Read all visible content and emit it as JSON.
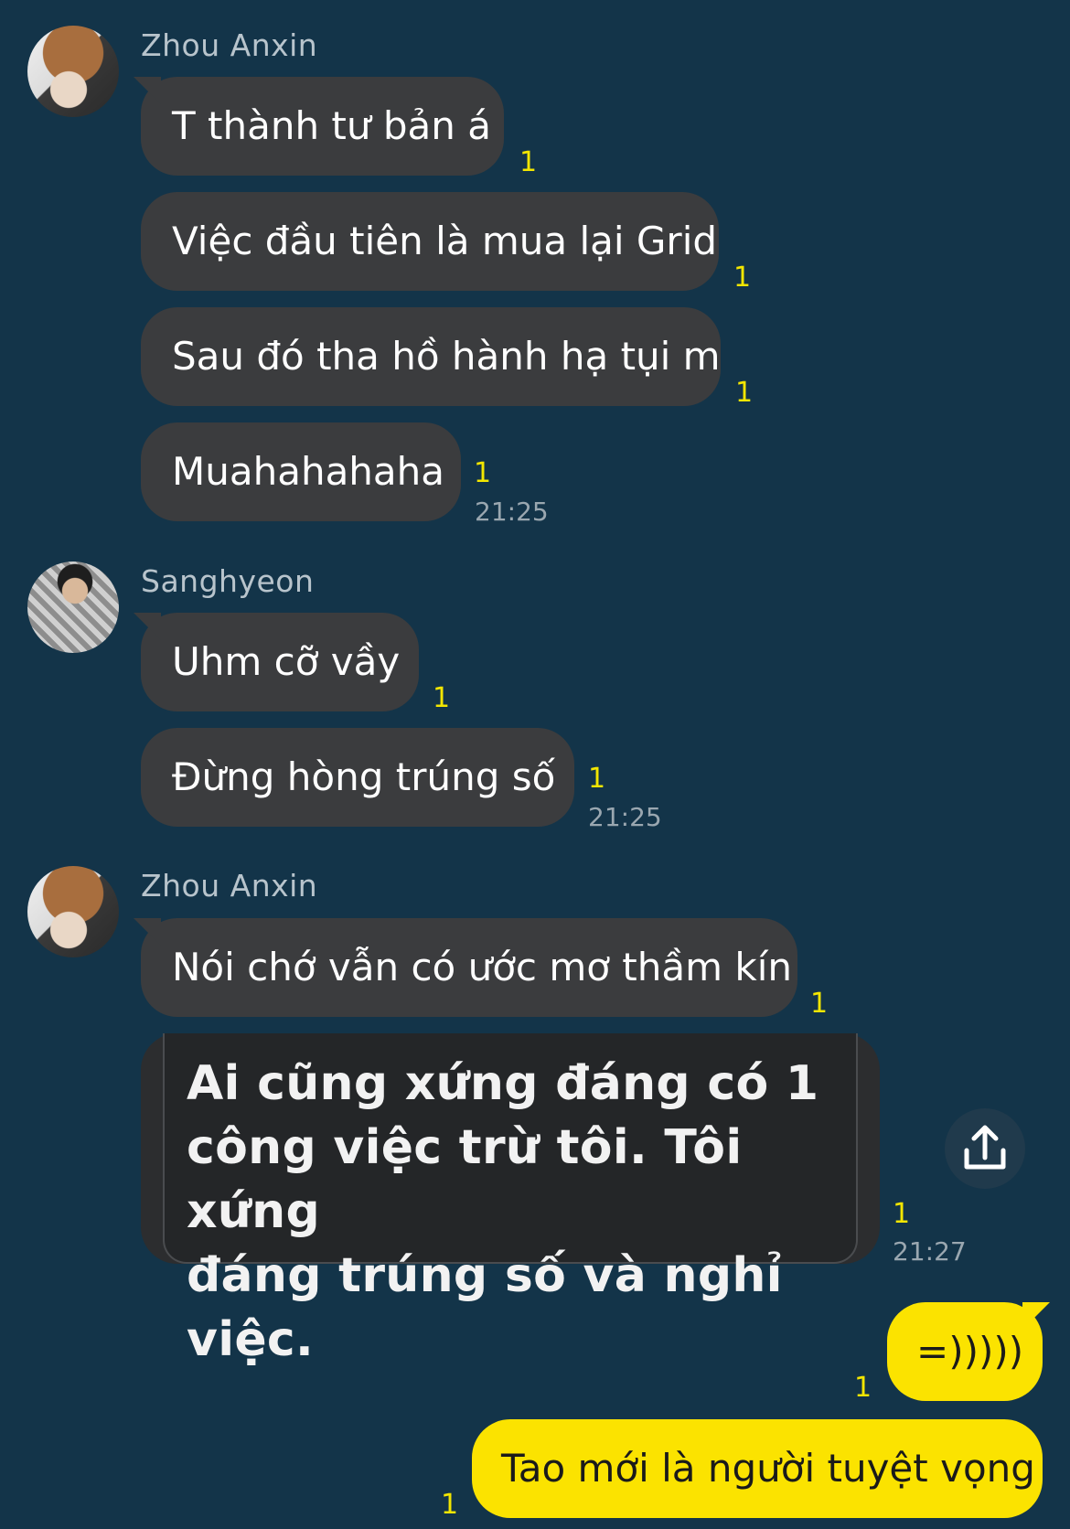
{
  "groups": [
    {
      "sender": "Zhou Anxin",
      "messages": [
        {
          "text": "T thành tư bản á",
          "count": "1"
        },
        {
          "text": "Việc đầu tiên là mua lại Grid",
          "count": "1"
        },
        {
          "text": "Sau đó tha hồ hành hạ tụi m",
          "count": "1"
        },
        {
          "text": "Muahahahaha",
          "count": "1"
        }
      ],
      "time": "21:25"
    },
    {
      "sender": "Sanghyeon",
      "messages": [
        {
          "text": "Uhm cỡ vầy",
          "count": "1"
        },
        {
          "text": "Đừng hòng trúng số",
          "count": "1"
        }
      ],
      "time": "21:25"
    },
    {
      "sender": "Zhou Anxin",
      "messages": [
        {
          "text": "Nói chớ vẫn có ước mơ thầm kín",
          "count": "1"
        }
      ],
      "quote": {
        "line1": "Ai cũng xứng đáng có 1",
        "line2": "công việc trừ tôi. Tôi xứng",
        "line3": "đáng trúng số và nghỉ việc.",
        "count": "1"
      },
      "time": "21:27"
    }
  ],
  "my_messages": [
    {
      "text": "=)))))",
      "count": "1"
    },
    {
      "text": "Tao mới là người tuyệt vọng",
      "count": "1"
    }
  ],
  "icons": {
    "share": "share-upload-icon"
  },
  "colors": {
    "background": "#133449",
    "incoming_bubble": "#3b3c3e",
    "outgoing_bubble": "#fbe300",
    "unread_count": "#f3e600"
  }
}
